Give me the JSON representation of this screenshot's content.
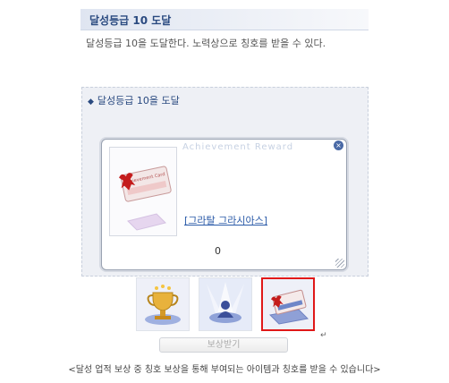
{
  "header": {
    "title": "달성등급 10 도달"
  },
  "description": "달성등급 10을 도달한다. 노력상으로 칭호를 받을 수 있다.",
  "panel": {
    "heading": "달성등급 10을 도달",
    "bullet": "◆"
  },
  "dialog": {
    "ghost_title": "Achievement Reward",
    "item_name": "[그라탈 그라시아스]",
    "count": "0",
    "card_text": "Achievement Card"
  },
  "rewards": [
    {
      "icon": "trophy-icon",
      "selected": false
    },
    {
      "icon": "blessing-figure-icon",
      "selected": false
    },
    {
      "icon": "title-card-icon",
      "selected": true
    }
  ],
  "claim_button": "보상받기",
  "return_mark": "↵",
  "caption": "<달성 업적 보상 중 칭호 보상을 통해 부여되는 아이템과 칭호를 받을 수 있습니다>"
}
